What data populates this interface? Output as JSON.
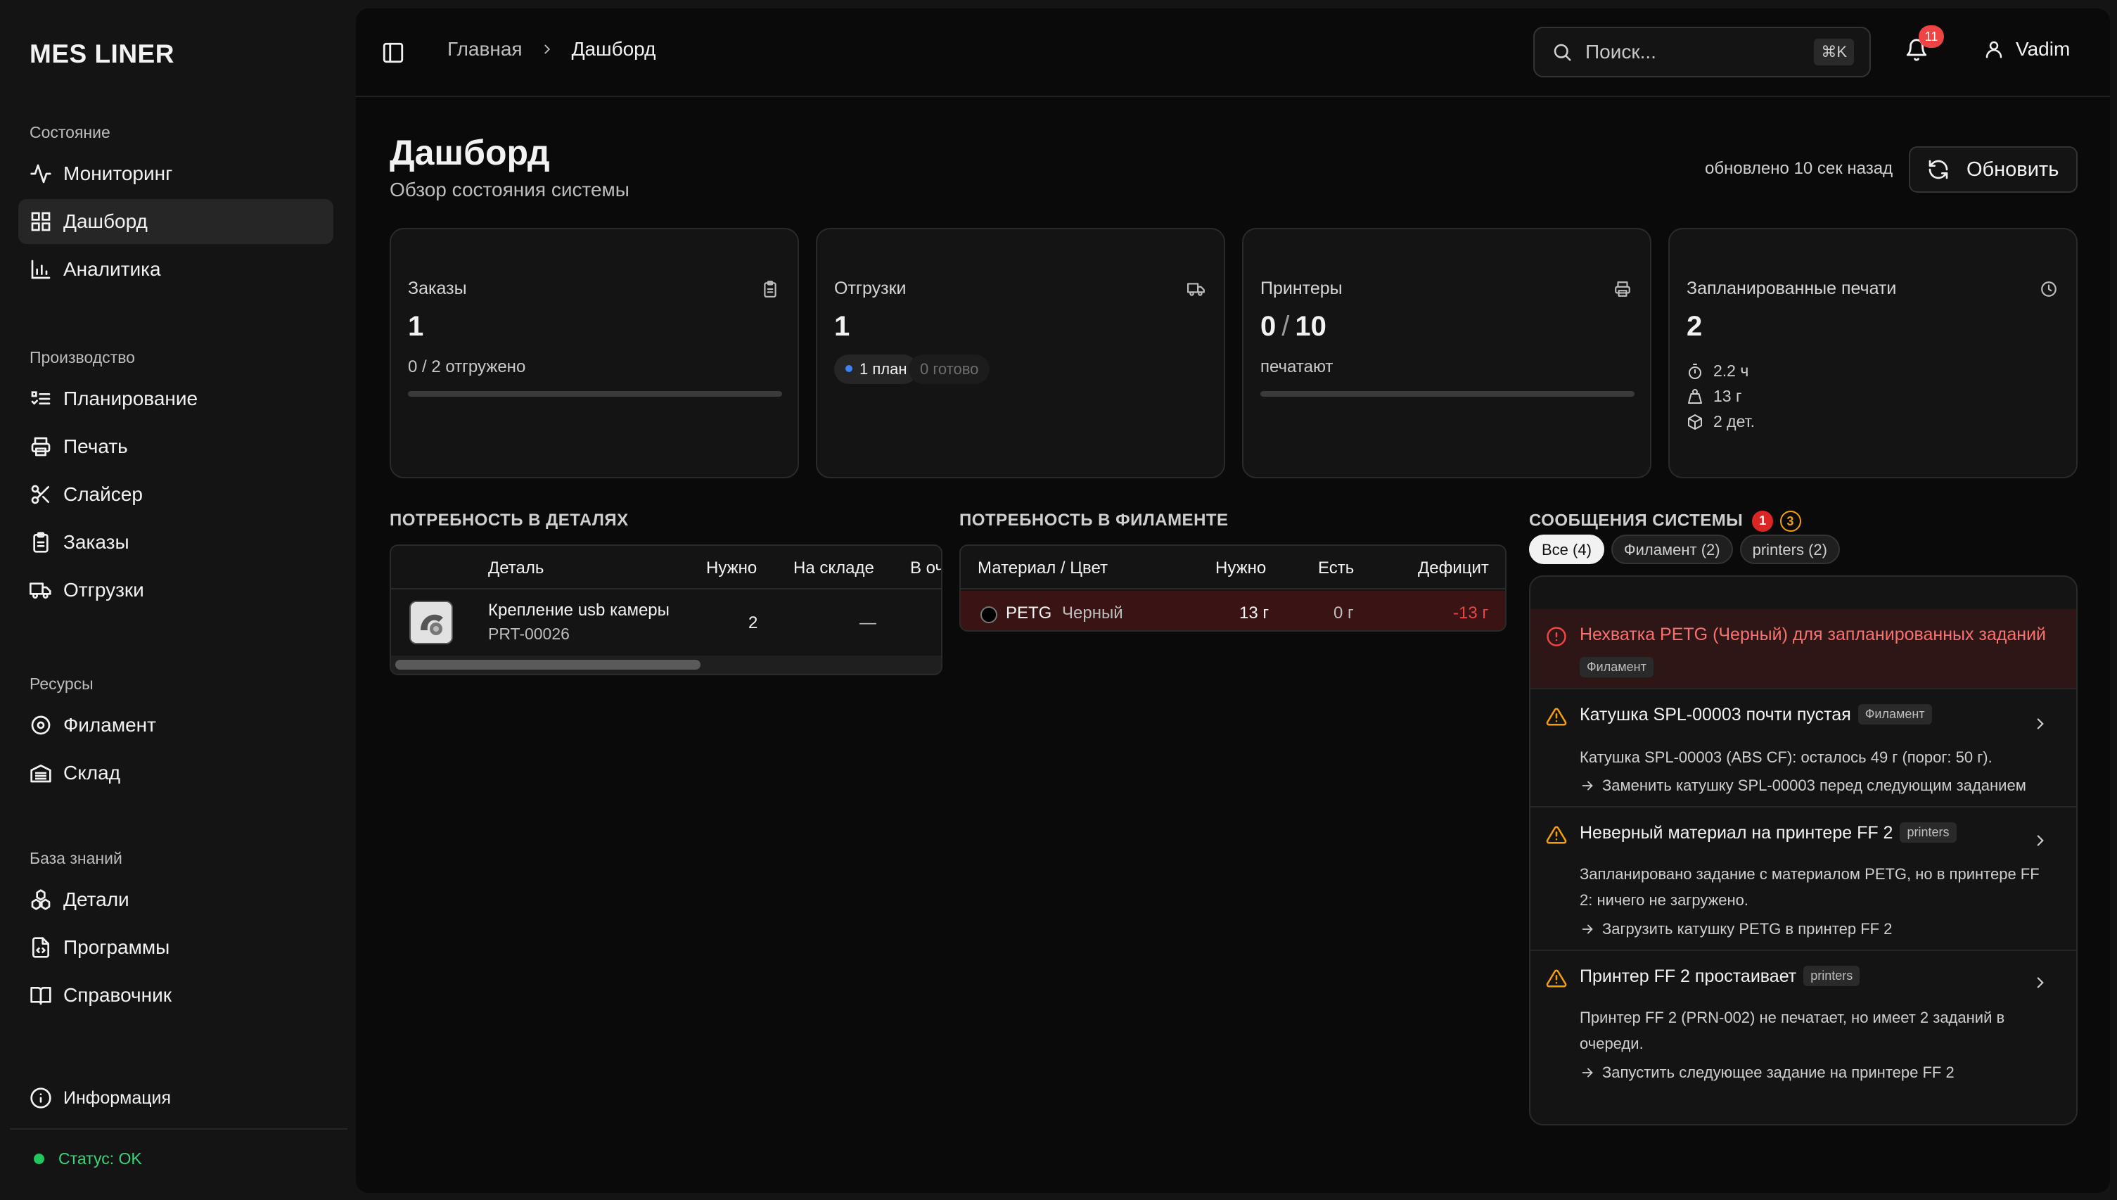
{
  "app": {
    "brand": "MES LINER"
  },
  "sidebar": {
    "groups": [
      {
        "title": "Состояние",
        "items": [
          {
            "label": "Мониторинг",
            "icon": "activity-icon"
          },
          {
            "label": "Дашборд",
            "icon": "dashboard-icon",
            "active": true
          },
          {
            "label": "Аналитика",
            "icon": "bar-chart-icon"
          }
        ]
      },
      {
        "title": "Производство",
        "items": [
          {
            "label": "Планирование",
            "icon": "list-checks-icon"
          },
          {
            "label": "Печать",
            "icon": "printer-icon"
          },
          {
            "label": "Слайсер",
            "icon": "scissors-icon"
          },
          {
            "label": "Заказы",
            "icon": "clipboard-icon"
          },
          {
            "label": "Отгрузки",
            "icon": "truck-icon"
          }
        ]
      },
      {
        "title": "Ресурсы",
        "items": [
          {
            "label": "Филамент",
            "icon": "spool-icon"
          },
          {
            "label": "Склад",
            "icon": "warehouse-icon"
          }
        ]
      },
      {
        "title": "База знаний",
        "items": [
          {
            "label": "Детали",
            "icon": "parts-icon"
          },
          {
            "label": "Программы",
            "icon": "file-code-icon"
          },
          {
            "label": "Справочник",
            "icon": "book-icon"
          }
        ]
      }
    ],
    "info_label": "Информация",
    "status_label": "Статус: OK"
  },
  "topbar": {
    "breadcrumb_home": "Главная",
    "breadcrumb_current": "Дашборд",
    "search_placeholder": "Поиск...",
    "search_shortcut": "⌘K",
    "notifications_count": "11",
    "user_name": "Vadim"
  },
  "page": {
    "title": "Дашборд",
    "subtitle": "Обзор состояния системы",
    "updated": "обновлено 10 сек назад",
    "refresh_label": "Обновить"
  },
  "cards": {
    "orders": {
      "title": "Заказы",
      "value": "1",
      "sub": "0 / 2 отгружено",
      "progress": 0
    },
    "shipments": {
      "title": "Отгрузки",
      "value": "1",
      "pill_plan": "1 план",
      "pill_ready": "0 готово"
    },
    "printers": {
      "title": "Принтеры",
      "value_active": "0",
      "value_total": "10",
      "sub": "печатают",
      "progress": 0
    },
    "scheduled": {
      "title": "Запланированные печати",
      "value": "2",
      "time": "2.2 ч",
      "weight": "13 г",
      "parts": "2 дет."
    }
  },
  "parts_need": {
    "title": "ПОТРЕБНОСТЬ В ДЕТАЛЯХ",
    "columns": [
      "Деталь",
      "Нужно",
      "На складе",
      "В очереди"
    ],
    "rows": [
      {
        "name": "Крепление usb камеры",
        "code": "PRT-00026",
        "need": "2",
        "stock": "—"
      }
    ]
  },
  "filament_need": {
    "title": "ПОТРЕБНОСТЬ В ФИЛАМЕНТЕ",
    "columns": [
      "Материал / Цвет",
      "Нужно",
      "Есть",
      "Дефицит"
    ],
    "rows": [
      {
        "material": "PETG",
        "color": "Черный",
        "need": "13 г",
        "have": "0 г",
        "deficit": "-13 г"
      }
    ]
  },
  "messages": {
    "title": "СООБЩЕНИЯ СИСТЕМЫ",
    "count_errors": "1",
    "count_warnings": "3",
    "filters": [
      "Все (4)",
      "Филамент (2)",
      "printers (2)"
    ],
    "items": [
      {
        "level": "error",
        "title": "Нехватка PETG (Черный) для запланированных заданий",
        "tag": "Филамент"
      },
      {
        "level": "warning",
        "title": "Катушка SPL-00003 почти пустая",
        "tag": "Филамент",
        "text": "Катушка SPL-00003 (ABS CF): осталось 49 г (порог: 50 г).",
        "action": "Заменить катушку SPL-00003 перед следующим заданием"
      },
      {
        "level": "warning",
        "title": "Неверный материал на принтере FF 2",
        "tag": "printers",
        "text": "Запланировано задание с материалом PETG, но в принтере FF 2: ничего не загружено.",
        "action": "Загрузить катушку PETG в принтер FF 2"
      },
      {
        "level": "warning",
        "title": "Принтер FF 2 простаивает",
        "tag": "printers",
        "text": "Принтер FF 2 (PRN-002) не печатает, но имеет 2 заданий в очереди.",
        "action": "Запустить следующее задание на принтере FF 2"
      }
    ]
  },
  "colors": {
    "accent_ok": "#22c55e",
    "error": "#ef4444",
    "warning": "#f59e0b",
    "plan_dot": "#3b82f6"
  }
}
